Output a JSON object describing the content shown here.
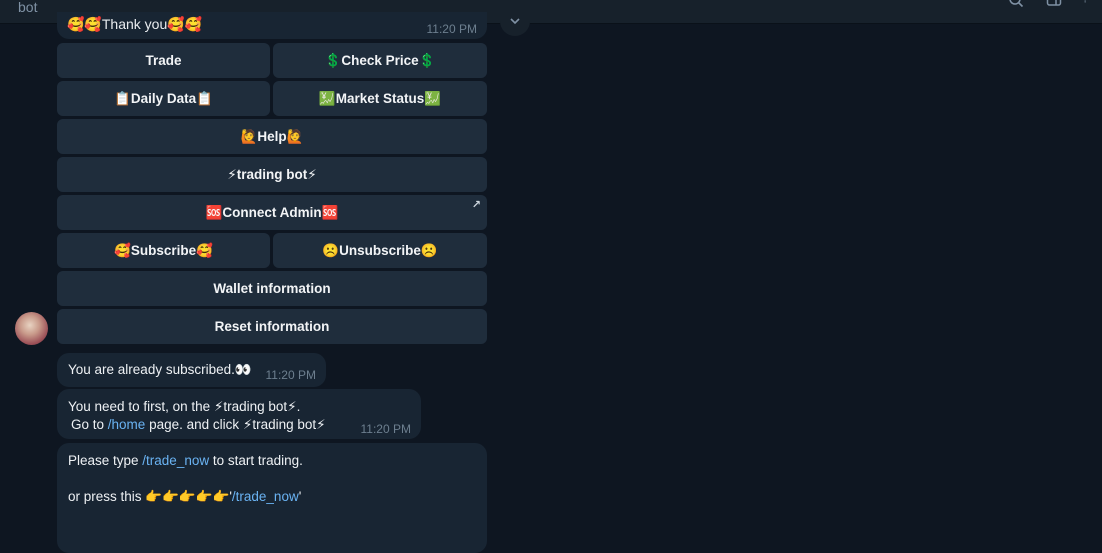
{
  "window": {
    "title": "bot"
  },
  "partial_message": {
    "text": "🥰🥰Thank you🥰🥰",
    "time": "11:20 PM"
  },
  "keyboard": {
    "trade": "Trade",
    "check_price": "💲Check Price💲",
    "daily_data": "📋Daily Data📋",
    "market_status": "💹Market Status💹",
    "help": "🙋Help🙋",
    "trading_bot": "⚡trading bot⚡",
    "connect_admin": "🆘Connect Admin🆘",
    "subscribe": "🥰Subscribe🥰",
    "unsubscribe": "☹️Unsubscribe☹️",
    "wallet_information": "Wallet information",
    "reset_information": "Reset information",
    "connect_admin_badge": "↗"
  },
  "messages": {
    "subscribed": {
      "text": "You are already subscribed.👀",
      "time": "11:20 PM"
    },
    "need_first": {
      "line1": "You need to first, on the ⚡trading bot⚡.",
      "line2_prefix": "Go to ",
      "line2_link": "/home",
      "line2_suffix": " page. and click ⚡trading bot⚡",
      "time": "11:20 PM"
    },
    "type_trade": {
      "line1_prefix": "Please type ",
      "line1_link": "/trade_now",
      "line1_suffix": " to start trading.",
      "line2_prefix": "or press this 👉👉👉👉👉'",
      "line2_link": "/trade_now",
      "line2_suffix": "'"
    }
  },
  "icons": [
    "search-icon",
    "columns-icon",
    "more-vertical-icon",
    "scroll-down-icon",
    "external-link-icon"
  ],
  "colors": {
    "background": "#0e1621",
    "bubble": "#182533",
    "keyboard_button": "#1f2d3c",
    "link": "#6ab3f3",
    "timestamp": "#6d7f8f"
  }
}
